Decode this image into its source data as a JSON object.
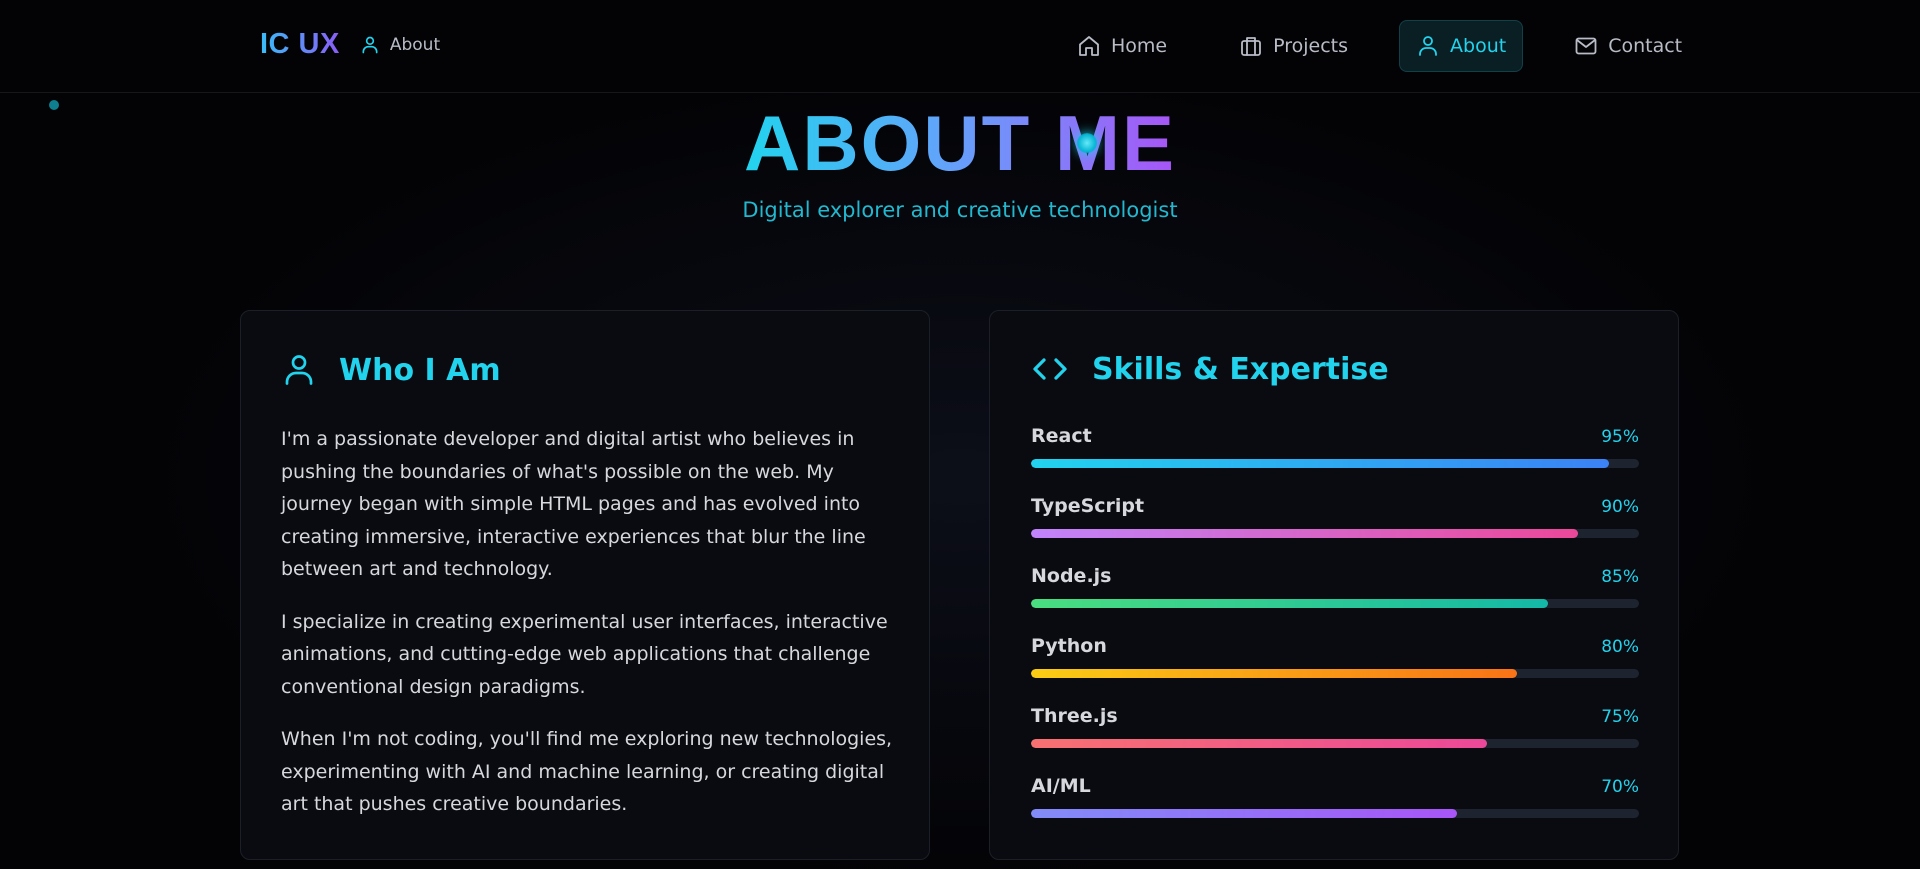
{
  "nav": {
    "logo": "IC UX",
    "current_page": "About",
    "links": [
      {
        "label": "Home",
        "icon": "home-icon",
        "active": false
      },
      {
        "label": "Projects",
        "icon": "briefcase-icon",
        "active": false
      },
      {
        "label": "About",
        "icon": "user-icon",
        "active": true
      },
      {
        "label": "Contact",
        "icon": "mail-icon",
        "active": false
      }
    ]
  },
  "hero": {
    "title": "ABOUT ME",
    "subtitle": "Digital explorer and creative technologist"
  },
  "who": {
    "title": "Who I Am",
    "icon": "user-icon",
    "paragraphs": [
      "I'm a passionate developer and digital artist who believes in pushing the boundaries of what's possible on the web. My journey began with simple HTML pages and has evolved into creating immersive, interactive experiences that blur the line between art and technology.",
      "I specialize in creating experimental user interfaces, interactive animations, and cutting-edge web applications that challenge conventional design paradigms.",
      "When I'm not coding, you'll find me exploring new technologies, experimenting with AI and machine learning, or creating digital art that pushes creative boundaries."
    ]
  },
  "skills": {
    "title": "Skills & Expertise",
    "icon": "code-icon",
    "items": [
      {
        "name": "React",
        "percent_label": "95%",
        "level": 0.95,
        "colors": [
          "#22d3ee",
          "#3b82f6"
        ]
      },
      {
        "name": "TypeScript",
        "percent_label": "90%",
        "level": 0.9,
        "colors": [
          "#c084fc",
          "#ec4899"
        ]
      },
      {
        "name": "Node.js",
        "percent_label": "85%",
        "level": 0.85,
        "colors": [
          "#4ade80",
          "#14b8a6"
        ]
      },
      {
        "name": "Python",
        "percent_label": "80%",
        "level": 0.8,
        "colors": [
          "#facc15",
          "#f97316"
        ]
      },
      {
        "name": "Three.js",
        "percent_label": "75%",
        "level": 0.75,
        "colors": [
          "#f87171",
          "#ec4899"
        ]
      },
      {
        "name": "AI/ML",
        "percent_label": "70%",
        "level": 0.7,
        "colors": [
          "#818cf8",
          "#a855f7"
        ]
      }
    ]
  },
  "colors": {
    "accent": "#22d3ee",
    "background": "#030306",
    "card": "#090b10"
  }
}
